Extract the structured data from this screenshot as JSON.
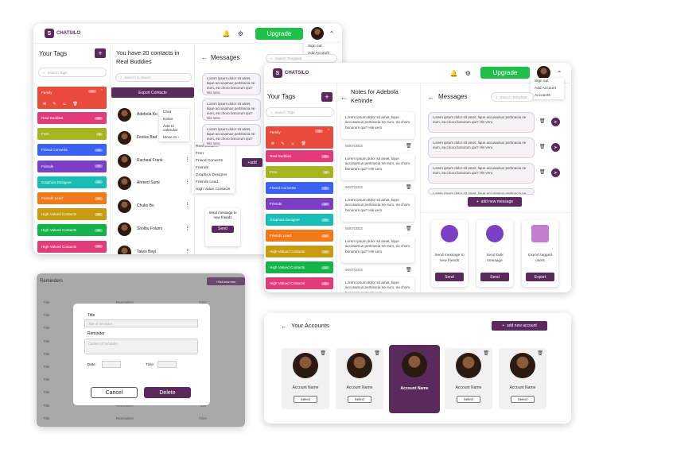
{
  "app": {
    "logo_text": "CHATSILO",
    "upgrade_label": "Upgrade"
  },
  "profile_menu": {
    "items": [
      "Sign out",
      "Add Account",
      "Accounts"
    ]
  },
  "tags_panel": {
    "title": "Your Tags",
    "search_placeholder": "Search Tags",
    "tags": [
      {
        "label": "Family",
        "count": "10",
        "color": "#ea4a3c"
      },
      {
        "label": "Real Buddies",
        "count": "20",
        "color": "#e23b7c"
      },
      {
        "label": "Fren",
        "count": "8",
        "color": "#a6b51f"
      },
      {
        "label": "Friend Converts",
        "count": "10",
        "color": "#3b62f0"
      },
      {
        "label": "Friends",
        "count": "10",
        "color": "#7b3fc6"
      },
      {
        "label": "Graphics Designer",
        "count": "10",
        "color": "#18bdb5"
      },
      {
        "label": "Friends Lead",
        "count": "10",
        "color": "#f07a1a"
      },
      {
        "label": "High Valued Contacts",
        "count": "10",
        "color": "#c89b10"
      },
      {
        "label": "High Valued Contacts",
        "count": "10",
        "color": "#15b44a"
      },
      {
        "label": "High Valued Contacts",
        "count": "10",
        "color": "#e23b7c"
      }
    ]
  },
  "contacts_panel": {
    "title": "You have 20 contacts in Real Buddies",
    "search_placeholder": "Search Contacts",
    "export_label": "Export Contacts",
    "contacts": [
      "Adebola Ke",
      "Festus Bad",
      "Racheal Frank",
      "Ahmed Sumi",
      "Chuks Bo",
      "Sholbu Folumi",
      "Taiwo Beyi"
    ],
    "context_menu": [
      "Chat",
      "Notes",
      "Add to calendar",
      "Move to"
    ],
    "move_to_menu": [
      "Real Buddies",
      "Fren",
      "Friend Converts",
      "Friends",
      "Graphics Designer",
      "Friends Lead",
      "High Value Contacts"
    ],
    "send_card": {
      "text": "Send message to new friends",
      "button": "Send"
    },
    "add_label": "add"
  },
  "messages_panel": {
    "title": "Messages",
    "search_placeholder": "Search Template",
    "message_text": "Lorem ipsum dolor sit amet, lique accusamus pertinacia ne eum, ea choro bonorum qui? His vero",
    "add_label": "add new message",
    "tiles": [
      {
        "text": "Send message to new friends",
        "button": "Send"
      },
      {
        "text": "Send bulk message",
        "button": "Send"
      },
      {
        "text": "Export tagged users",
        "button": "Export"
      }
    ]
  },
  "notes_panel": {
    "title": "Notes for Adebola Kehinde",
    "note_text": "Lorem ipsum dolor sit amet, lique accusamus pertinacia ne eum, ea choro bonorum qui? His vero",
    "date": "06/07/2022"
  },
  "reminders": {
    "title": "Reminders",
    "set_label": "Set new rem",
    "column": "Title",
    "column2": "Reminders",
    "column3": "Time",
    "modal": {
      "title_label": "Title",
      "title_placeholder": "Title of reminder",
      "reminder_label": "Reminder",
      "reminder_placeholder": "Content of reminder",
      "date_label": "Date:",
      "time_label": "Time:",
      "cancel": "Cancel",
      "delete": "Delete"
    }
  },
  "accounts": {
    "title": "Your Accounts",
    "add_label": "add new account",
    "account_name": "Account Name",
    "select_label": "Select"
  }
}
